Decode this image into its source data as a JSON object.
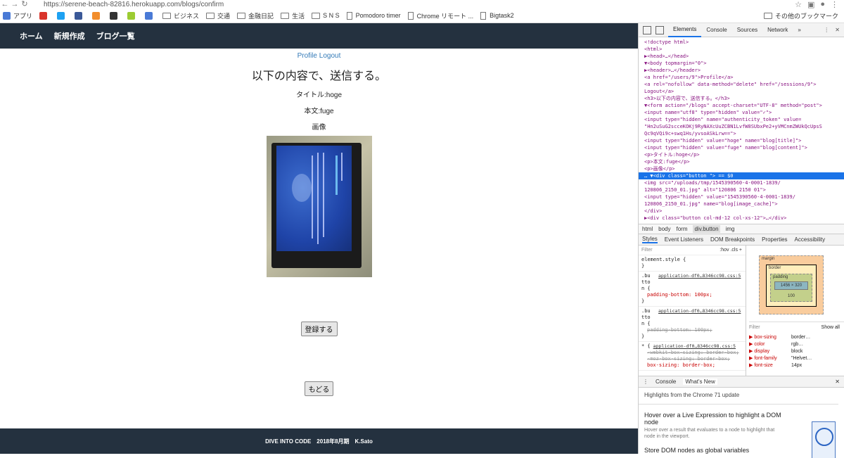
{
  "browser": {
    "url": "https://serene-beach-82816.herokuapp.com/blogs/confirm",
    "bookmarks": [
      {
        "label": "アプリ",
        "color": "#4a7ad6"
      },
      {
        "label": "",
        "color": "#d9342b"
      },
      {
        "label": "",
        "color": "#1da1f2"
      },
      {
        "label": "",
        "color": "#3b5998"
      },
      {
        "label": "",
        "color": "#f28d2c"
      },
      {
        "label": "",
        "color": "#333333"
      },
      {
        "label": "",
        "color": "#9ccc32"
      },
      {
        "label": "",
        "color": "#4a7ad6"
      },
      {
        "label": "ビジネス",
        "color": "folder"
      },
      {
        "label": "交通",
        "color": "folder"
      },
      {
        "label": "金融日記",
        "color": "folder"
      },
      {
        "label": "生活",
        "color": "folder"
      },
      {
        "label": "S N S",
        "color": "folder"
      },
      {
        "label": "Pomodoro timer",
        "color": "doc"
      },
      {
        "label": "Chrome リモート ...",
        "color": "doc"
      },
      {
        "label": "Bigtask2",
        "color": "doc"
      }
    ],
    "other_bookmarks": "その他のブックマーク"
  },
  "app": {
    "nav": {
      "home": "ホーム",
      "new": "新規作成",
      "list": "ブログ一覧"
    },
    "profile": "Profile",
    "logout": "Logout",
    "heading": "以下の内容で、送信する。",
    "title_line": "タイトル:hoge",
    "body_line": "本文:fuge",
    "image_label": "画像",
    "register_button": "登録する",
    "back_button": "もどる",
    "footer": "DIVE INTO CODE　2018年8月期　K.Sato"
  },
  "devtools": {
    "tabs": [
      "Elements",
      "Console",
      "Sources",
      "Network"
    ],
    "more": "»",
    "tree": [
      "<!doctype html>",
      "<html>",
      "▶<head>…</head>",
      "▼<body topmargin=\"0\">",
      "  ▶<header>…</header>",
      "    <a href=\"/users/9\">Profile</a>",
      "    <a rel=\"nofollow\" data-method=\"delete\" href=\"/sessions/9\">",
      "    Logout</a>",
      "    <h3>以下の内容で、送信する。</h3>",
      "  ▼<form action=\"/blogs\" accept-charset=\"UTF-8\" method=\"post\">",
      "      <input name=\"utf8\" type=\"hidden\" value=\"✓\">",
      "      <input type=\"hidden\" name=\"authenticity_token\" value=",
      "      \"Hn2uSuG2scceKOKj9RyNAXcUuZCBN1LvfW8SUbxPe2+yVMCnmZWUkQcUpsS",
      "      Qc9qVQi9c+swq1Hs/yvsoASkLrw==\">",
      "      <input type=\"hidden\" value=\"hoge\" name=\"blog[title]\">",
      "      <input type=\"hidden\" value=\"fuge\" name=\"blog[content]\">",
      "      <p>タイトル:hoge</p>",
      "      <p>本文:fuge</p>",
      "      <p>画像</p>",
      "…   ▼<div class=\"button \"> == $0",
      "        <img src=\"/uploads/tmp/1545390560-4-0001-1839/",
      "        120806_2150_01.jpg\" alt=\"120806 2150 01\">",
      "        <input type=\"hidden\" value=\"1545390560-4-0001-1839/",
      "        120806_2150_01.jpg\" name=\"blog[image_cache]\">",
      "      </div>",
      "    ▶<div class=\"button col-md-12 col-xs-12\">…</div>"
    ],
    "selected_index": 19,
    "breadcrumbs": [
      "html",
      "body",
      "form",
      "div.button",
      "img"
    ],
    "sub_tabs": [
      "Styles",
      "Event Listeners",
      "DOM Breakpoints",
      "Properties",
      "Accessibility"
    ],
    "filter_placeholder": "Filter",
    "filter_right": ":hov  .cls  +",
    "style_rules": [
      {
        "selector": "element.style {",
        "source": "",
        "props": [],
        "close": "}"
      },
      {
        "selector": ".bu tto n {",
        "source": "application-df0…8346cc98.css:5",
        "props": [
          "padding-bottom: 100px;"
        ],
        "strike": false,
        "close": "}"
      },
      {
        "selector": ".bu tto n {",
        "source": "application-df0…8346cc98.css:5",
        "props": [
          "padding-bottom: 100px;"
        ],
        "strike": true,
        "close": "}"
      },
      {
        "selector": "* {",
        "source": "application-df0…8346cc98.css:5",
        "props": [
          "-webkit-box-sizing: border-box;",
          "-moz-box-sizing: border-box;",
          "box-sizing: border-box;"
        ],
        "strike": false,
        "close": ""
      }
    ],
    "box_model": {
      "margin": "margin",
      "border": "border",
      "padding": "padding",
      "content": "1456 × 320",
      "bottom": "100",
      "dash": "-"
    },
    "computed_filter": "Filter",
    "show_all": "Show all",
    "computed": [
      {
        "name": "box-sizing",
        "value": "border…"
      },
      {
        "name": "color",
        "value": "rgb…"
      },
      {
        "name": "display",
        "value": "block"
      },
      {
        "name": "font-family",
        "value": "\"Helvet…"
      },
      {
        "name": "font-size",
        "value": "14px"
      }
    ],
    "drawer_tabs": [
      "Console",
      "What's New"
    ],
    "whats_new": {
      "subtitle": "Highlights from the Chrome 71 update",
      "item1_title": "Hover over a Live Expression to highlight a DOM node",
      "item1_desc": "Hover over a result that evaluates to a node to highlight that node in the viewport.",
      "item2_title": "Store DOM nodes as global variables"
    }
  }
}
